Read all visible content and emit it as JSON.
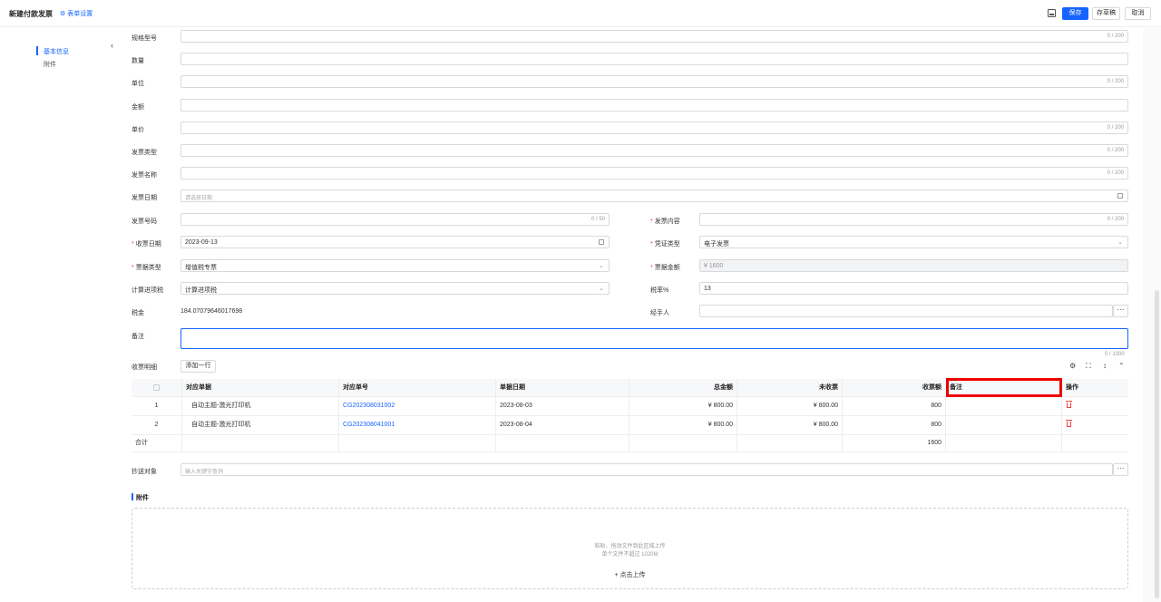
{
  "header": {
    "title": "新建付款发票",
    "form_settings": "表单设置",
    "save": "保存",
    "draft": "存草稿",
    "cancel": "取消"
  },
  "sidebar": {
    "items": [
      {
        "label": "基本信息",
        "active": true
      },
      {
        "label": "附件",
        "active": false
      }
    ]
  },
  "form": {
    "spec_model": {
      "label": "规格型号",
      "counter": "0 / 200"
    },
    "quantity": {
      "label": "数量"
    },
    "unit": {
      "label": "单位",
      "counter": "0 / 200"
    },
    "amount": {
      "label": "金额"
    },
    "unit_price": {
      "label": "单价",
      "counter": "0 / 200"
    },
    "invoice_type": {
      "label": "发票类型",
      "counter": "0 / 200"
    },
    "invoice_name": {
      "label": "发票名称",
      "counter": "0 / 200"
    },
    "invoice_date": {
      "label": "发票日期",
      "placeholder": "请选择日期"
    },
    "invoice_number": {
      "label": "发票号码",
      "counter": "0 / 50"
    },
    "invoice_content": {
      "label": "发票内容",
      "counter": "0 / 200"
    },
    "receive_date": {
      "label": "收票日期",
      "value": "2023-09-13"
    },
    "voucher_type": {
      "label": "凭证类型",
      "value": "电子发票"
    },
    "bill_type": {
      "label": "票据类型",
      "value": "增值税专票"
    },
    "bill_amount": {
      "label": "票据金额",
      "value": "¥ 1600"
    },
    "tax_calc": {
      "label": "计算进项税",
      "value": "计算进项税"
    },
    "tax_rate": {
      "label": "税率%",
      "value": "13"
    },
    "tax": {
      "label": "税金",
      "value": "184.07079646017698"
    },
    "handler": {
      "label": "经手人"
    },
    "remark": {
      "label": "备注",
      "counter": "0 / 1000"
    },
    "detail": {
      "label": "收票明细",
      "add_row": "添加一行"
    },
    "cc": {
      "label": "抄送对象",
      "placeholder": "输入关键字查询"
    }
  },
  "table": {
    "columns": [
      "",
      "对应单据",
      "对应单号",
      "单据日期",
      "总金额",
      "未收票",
      "收票额",
      "备注",
      "操作"
    ],
    "rows": [
      {
        "index": "1",
        "doc": "自动主题-激光打印机",
        "doc_no": "CG202308031002",
        "date": "2023-08-03",
        "total": "¥ 800.00",
        "uninvoiced": "¥ 800.00",
        "received": "800",
        "remark": ""
      },
      {
        "index": "2",
        "doc": "自动主题-激光打印机",
        "doc_no": "CG202308041001",
        "date": "2023-08-04",
        "total": "¥ 800.00",
        "uninvoiced": "¥ 800.00",
        "received": "800",
        "remark": ""
      }
    ],
    "summary": {
      "label": "合计",
      "received": "1600"
    }
  },
  "attachment": {
    "title": "附件",
    "hint1": "粘贴、拖动文件到此区域上传",
    "hint2": "单个文件不超过 1020M",
    "upload": "点击上传"
  },
  "colors": {
    "primary": "#1664ff",
    "required": "#f53f3f",
    "highlight": "#e00000"
  }
}
